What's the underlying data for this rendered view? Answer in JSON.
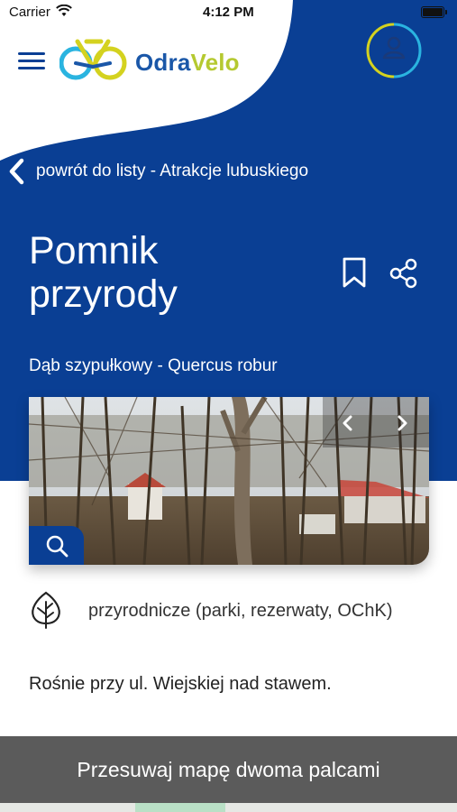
{
  "status_bar": {
    "carrier": "Carrier",
    "time": "4:12 PM"
  },
  "header": {
    "logo_part1": "Odra",
    "logo_part2": "Velo"
  },
  "back_link": {
    "label": "powrót do listy - Atrakcje lubuskiego"
  },
  "detail": {
    "title_line1": "Pomnik",
    "title_line2": "przyrody",
    "subtitle": "Dąb szypułkowy - Quercus robur",
    "category": "przyrodnicze (parki, rezerwaty, OChK)",
    "description": "Rośnie przy ul. Wiejskiej nad stawem."
  },
  "map": {
    "hint": "Przesuwaj mapę dwoma palcami"
  },
  "colors": {
    "brand_blue": "#0a3f94",
    "logo_yellow": "#d4d21f",
    "logo_cyan": "#2ab4e0"
  },
  "icons": {
    "menu": "hamburger-icon",
    "user": "user-icon",
    "back": "chevron-left-icon",
    "bookmark": "bookmark-icon",
    "share": "share-icon",
    "zoom": "search-icon",
    "category": "leaf-icon",
    "gallery_prev": "chevron-left-icon",
    "gallery_next": "chevron-right-icon"
  }
}
